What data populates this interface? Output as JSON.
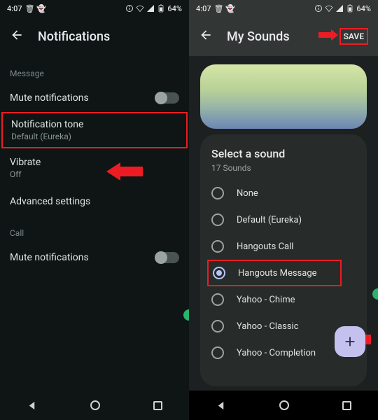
{
  "status": {
    "time": "4:07",
    "icons": "🗑 👻",
    "battery": "64%"
  },
  "left": {
    "title": "Notifications",
    "sections": {
      "message": {
        "label": "Message",
        "mute": "Mute notifications",
        "tone": {
          "label": "Notification tone",
          "value": "Default (Eureka)"
        },
        "vibrate": {
          "label": "Vibrate",
          "value": "Off"
        },
        "advanced": "Advanced settings"
      },
      "call": {
        "label": "Call",
        "mute": "Mute notifications"
      }
    }
  },
  "right": {
    "title": "My Sounds",
    "save": "SAVE",
    "select": {
      "title": "Select a sound",
      "count": "17 Sounds"
    },
    "sounds": [
      {
        "label": "None",
        "selected": false
      },
      {
        "label": "Default (Eureka)",
        "selected": false
      },
      {
        "label": "Hangouts Call",
        "selected": false
      },
      {
        "label": "Hangouts Message",
        "selected": true
      },
      {
        "label": "Yahoo - Chime",
        "selected": false
      },
      {
        "label": "Yahoo - Classic",
        "selected": false
      },
      {
        "label": "Yahoo - Completion",
        "selected": false
      }
    ]
  }
}
